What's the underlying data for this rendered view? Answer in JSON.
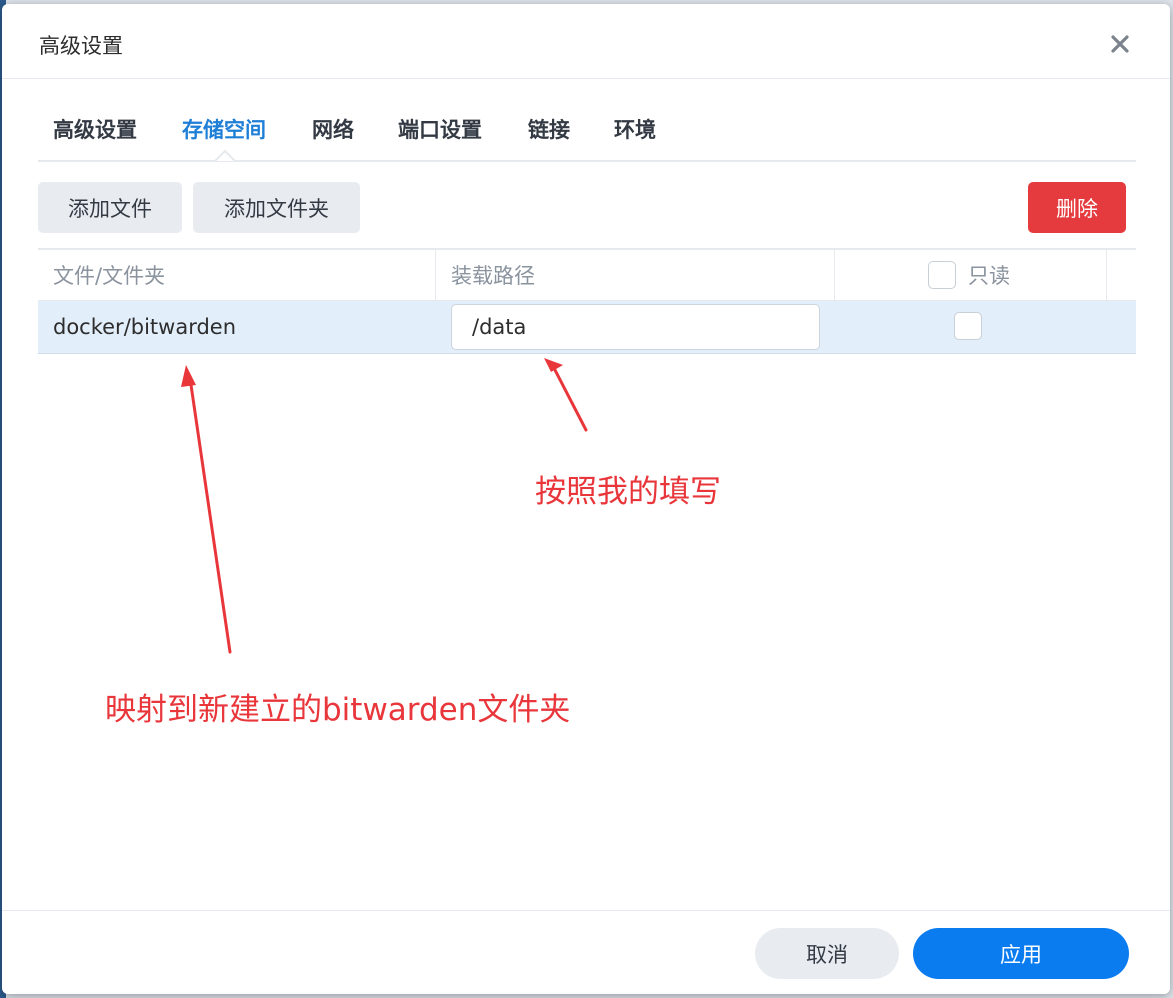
{
  "dialog": {
    "title": "高级设置"
  },
  "tabs": [
    {
      "label": "高级设置",
      "active": false
    },
    {
      "label": "存储空间",
      "active": true
    },
    {
      "label": "网络",
      "active": false
    },
    {
      "label": "端口设置",
      "active": false
    },
    {
      "label": "链接",
      "active": false
    },
    {
      "label": "环境",
      "active": false
    }
  ],
  "toolbar": {
    "add_file_label": "添加文件",
    "add_folder_label": "添加文件夹",
    "delete_label": "删除"
  },
  "table": {
    "columns": {
      "file_folder": "文件/文件夹",
      "mount_path": "装载路径",
      "readonly": "只读"
    },
    "rows": [
      {
        "file_folder": "docker/bitwarden",
        "mount_path": "/data",
        "readonly": false
      }
    ]
  },
  "annotations": {
    "fill_hint": "按照我的填写",
    "map_hint": "映射到新建立的bitwarden文件夹"
  },
  "footer": {
    "cancel_label": "取消",
    "apply_label": "应用"
  },
  "colors": {
    "accent": "#0a7cf0",
    "active_tab": "#1f7fd6",
    "danger": "#e53b3e",
    "annotation": "#e8363b",
    "selected_row": "#e3eefb"
  },
  "icons": {
    "close": "close-icon"
  }
}
